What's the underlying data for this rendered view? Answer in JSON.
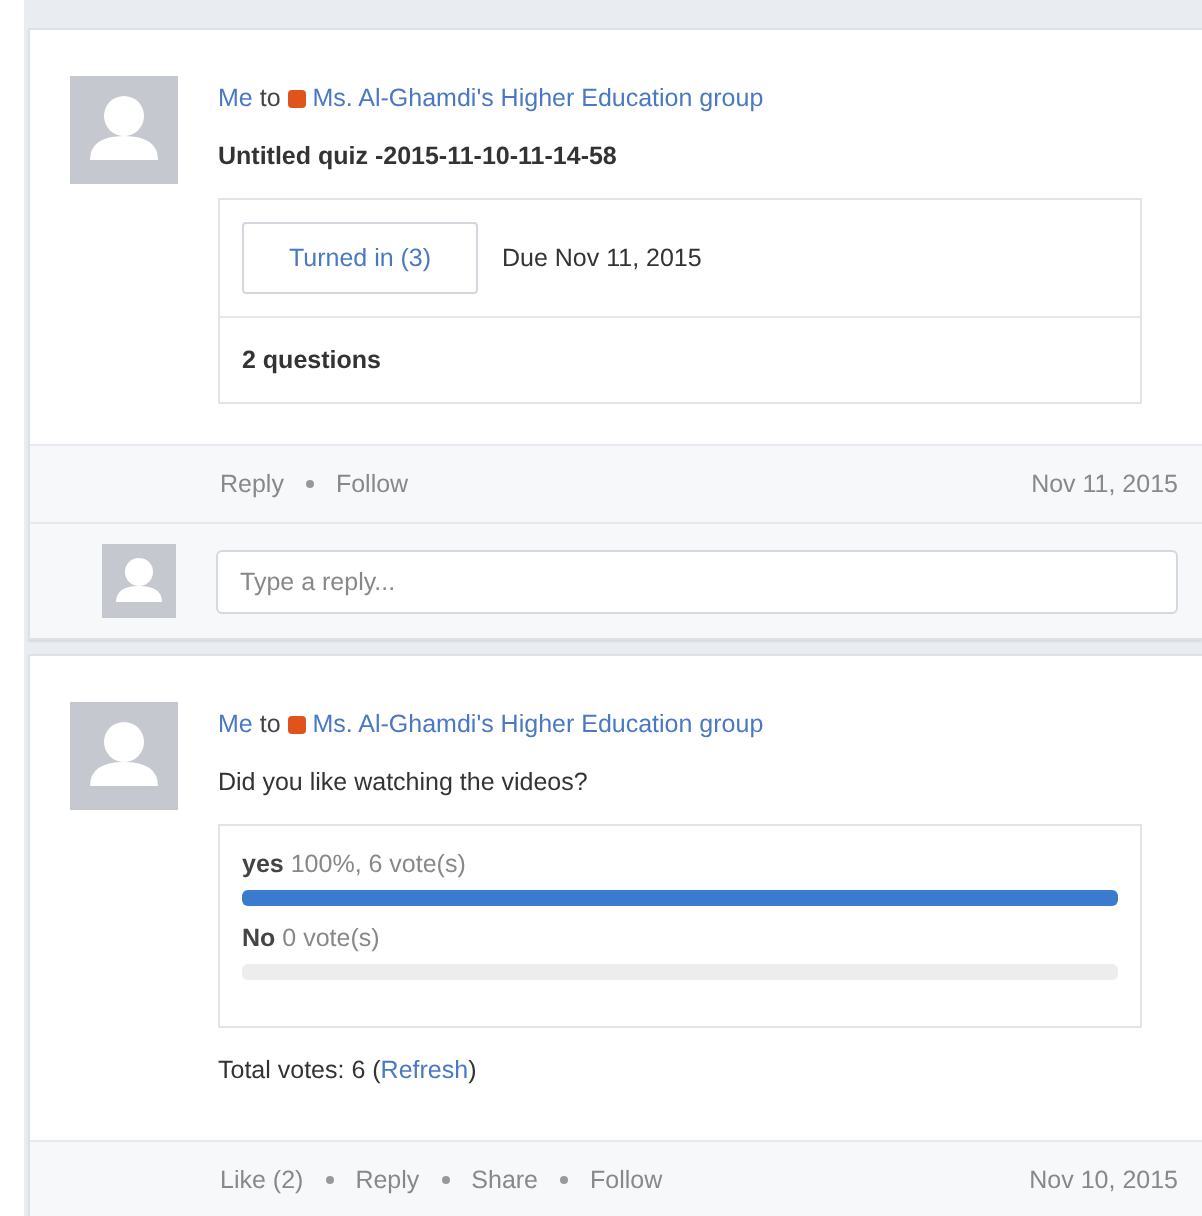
{
  "posts": [
    {
      "kind": "quiz",
      "author": "Me",
      "to": "to",
      "group": "Ms. Al-Ghamdi's Higher Education group",
      "title": "Untitled quiz -2015-11-10-11-14-58",
      "turned_in": "Turned in (3)",
      "due": "Due Nov 11, 2015",
      "questions": "2 questions",
      "actions": [
        "Reply",
        "Follow"
      ],
      "date": "Nov 11, 2015",
      "reply_placeholder": "Type a reply..."
    },
    {
      "kind": "poll",
      "author": "Me",
      "to": "to",
      "group": "Ms. Al-Ghamdi's Higher Education group",
      "question": "Did you like watching the videos?",
      "options": [
        {
          "label": "yes",
          "stats": "100%, 6 vote(s)",
          "level": 1
        },
        {
          "label": "No",
          "stats": "0 vote(s)",
          "level": 0
        }
      ],
      "total": "Total votes: 6 (",
      "refresh": "Refresh",
      "total_end": ")",
      "actions": [
        "Like (2)",
        "Reply",
        "Share",
        "Follow"
      ],
      "date": "Nov 10, 2015"
    }
  ]
}
